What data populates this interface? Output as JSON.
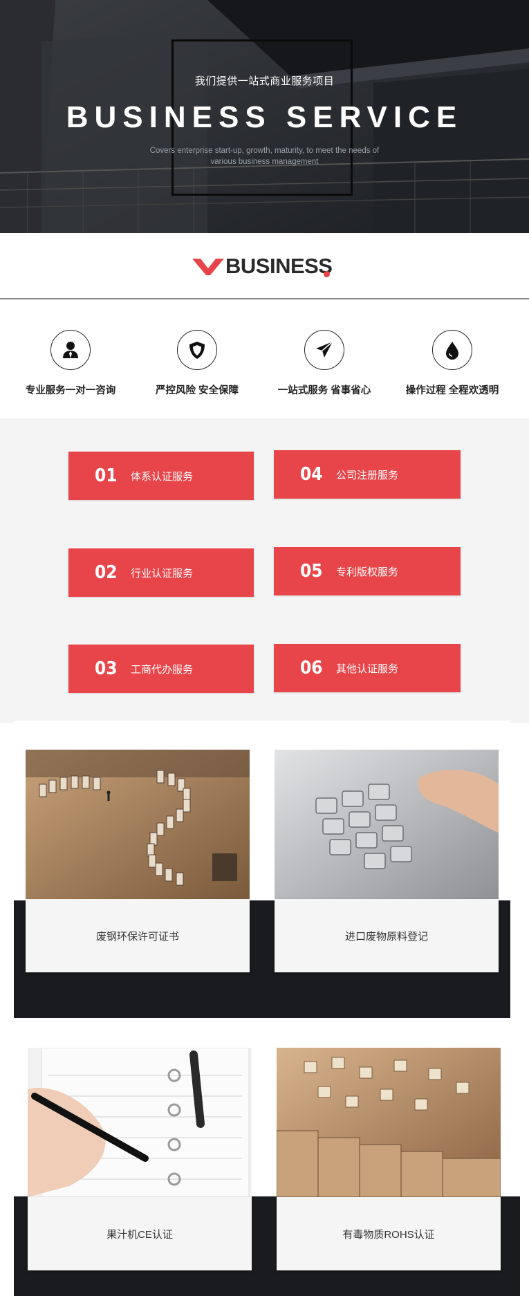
{
  "hero": {
    "subtitle": "我们提供一站式商业服务项目",
    "title": "BUSINESS SERVICE",
    "description": "Covers enterprise start-up, growth, maturity, to meet the needs of various business management"
  },
  "brand": {
    "name": "BUSINESS",
    "accent_color": "#e8454a"
  },
  "features": [
    {
      "icon": "person-icon",
      "label": "专业服务一对一咨询"
    },
    {
      "icon": "shield-icon",
      "label": "严控风险  安全保障"
    },
    {
      "icon": "paper-plane-icon",
      "label": "一站式服务  省事省心"
    },
    {
      "icon": "water-drop-icon",
      "label": "操作过程  全程欢透明"
    }
  ],
  "services": [
    {
      "num": "01",
      "label": "体系认证服务"
    },
    {
      "num": "02",
      "label": "行业认证服务"
    },
    {
      "num": "03",
      "label": "工商代办服务"
    },
    {
      "num": "04",
      "label": "公司注册服务"
    },
    {
      "num": "05",
      "label": "专利版权服务"
    },
    {
      "num": "06",
      "label": "其他认证服务"
    }
  ],
  "cards": [
    {
      "caption": "废钢环保许可证书",
      "image": "dominoes-question-mark"
    },
    {
      "caption": "进口废物原料登记",
      "image": "keypad-hand"
    },
    {
      "caption": "果汁机CE认证",
      "image": "pen-notebook"
    },
    {
      "caption": "有毒物质ROHS认证",
      "image": "scrabble-tiles"
    }
  ]
}
